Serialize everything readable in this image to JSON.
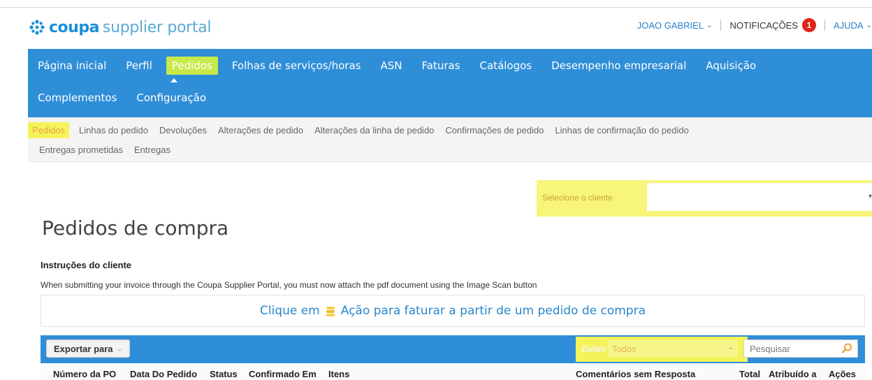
{
  "brand": {
    "logo_bold": "coupa",
    "logo_light": "supplier portal",
    "logo_color": "#1a8fd8"
  },
  "util": {
    "user": "JOAO GABRIEL",
    "notifications_label": "NOTIFICAÇÕES",
    "notifications_count": "1",
    "help": "AJUDA"
  },
  "mainnav": {
    "row1": [
      "Página inicial",
      "Perfil",
      "Pedidos",
      "Folhas de serviços/horas",
      "ASN",
      "Faturas",
      "Catálogos",
      "Desempenho empresarial",
      "Aquisição"
    ],
    "row2": [
      "Complementos",
      "Configuração"
    ],
    "active": "Pedidos",
    "bg_color": "#2f8ed8"
  },
  "subnav": {
    "row1": [
      "Pedidos",
      "Linhas do pedido",
      "Devoluções",
      "Alterações de pedido",
      "Alterações da linha de pedido",
      "Confirmações de pedido",
      "Linhas de confirmação do pedido"
    ],
    "row2": [
      "Entregas prometidas",
      "Entregas"
    ],
    "active": "Pedidos"
  },
  "client": {
    "label": "Selecione o cliente",
    "value": ""
  },
  "page": {
    "title": "Pedidos de compra",
    "instructions_heading": "Instruções do cliente",
    "instructions_text": "When submitting your invoice through the Coupa Supplier Portal, you must now attach the pdf document using the Image Scan button",
    "invoice_prefix": "Clique em",
    "invoice_suffix": "Ação para faturar a partir de um pedido de compra"
  },
  "toolbar": {
    "export_label": "Exportar para",
    "filter_label": "Exibir",
    "filter_value": "Todos",
    "search_placeholder": "Pesquisar"
  },
  "table": {
    "columns": [
      "Número da PO",
      "Data Do Pedido",
      "Status",
      "Confirmado Em",
      "Itens",
      "Comentários sem Resposta",
      "Total",
      "Atribuído a",
      "Ações"
    ]
  },
  "highlight_color": "#f5f35a"
}
